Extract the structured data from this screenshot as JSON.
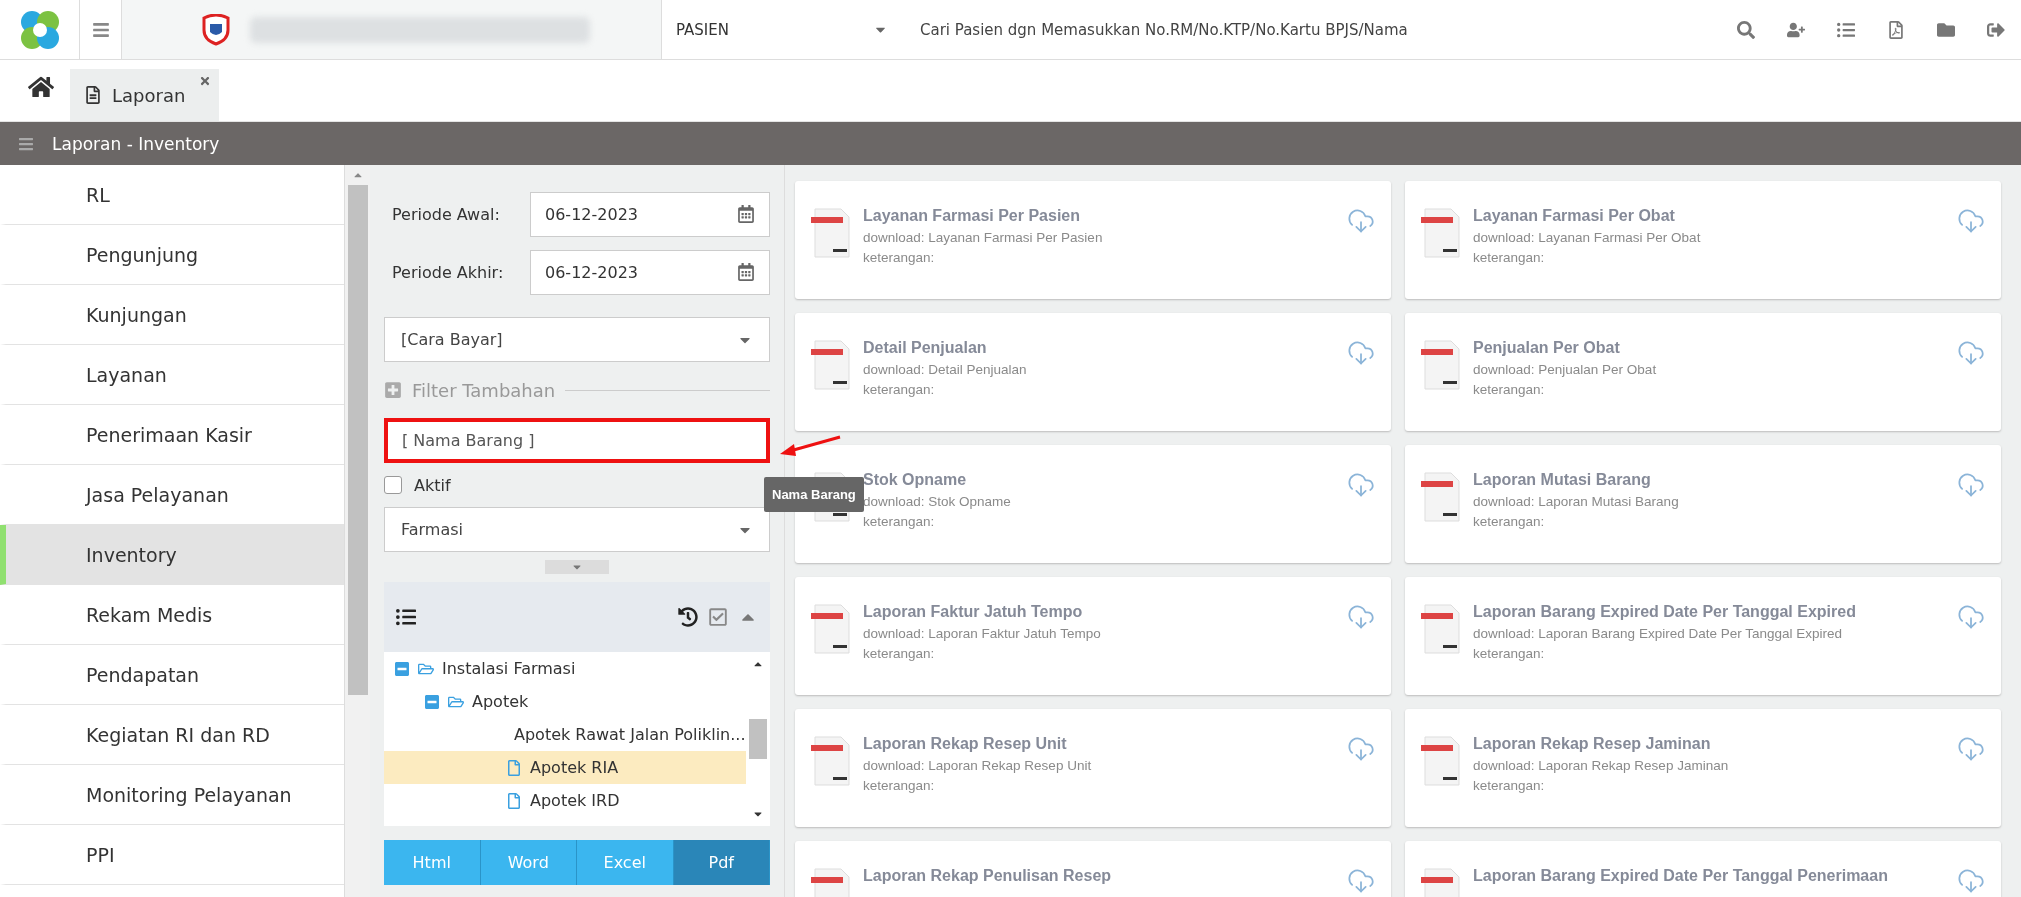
{
  "header": {
    "patient_select": "PASIEN",
    "search_placeholder": "Cari Pasien dgn Memasukkan No.RM/No.KTP/No.Kartu BPJS/Nama"
  },
  "tabs": [
    {
      "label": "Laporan",
      "selected": true
    }
  ],
  "section_title": "Laporan - Inventory",
  "sidebar": {
    "items": [
      {
        "label": "RL",
        "selected": false
      },
      {
        "label": "Pengunjung",
        "selected": false
      },
      {
        "label": "Kunjungan",
        "selected": false
      },
      {
        "label": "Layanan",
        "selected": false
      },
      {
        "label": "Penerimaan Kasir",
        "selected": false
      },
      {
        "label": "Jasa Pelayanan",
        "selected": false
      },
      {
        "label": "Inventory",
        "selected": true
      },
      {
        "label": "Rekam Medis",
        "selected": false
      },
      {
        "label": "Pendapatan",
        "selected": false
      },
      {
        "label": "Kegiatan RI dan RD",
        "selected": false
      },
      {
        "label": "Monitoring Pelayanan",
        "selected": false
      },
      {
        "label": "PPI",
        "selected": false
      }
    ]
  },
  "filters": {
    "period_start": {
      "label": "Periode Awal:",
      "value": "06-12-2023"
    },
    "period_end": {
      "label": "Periode Akhir:",
      "value": "06-12-2023"
    },
    "payment_select": "[Cara Bayar]",
    "extra_filter_label": "Filter Tambahan",
    "item_name": {
      "placeholder": "[ Nama Barang ]",
      "highlighted": true
    },
    "active": {
      "label": "Aktif",
      "checked": false
    },
    "unit_select": "Farmasi"
  },
  "tooltip": "Nama Barang",
  "tree": [
    {
      "label": "Instalasi Farmasi",
      "expanded": true,
      "selected": false,
      "children": [
        {
          "label": "Apotek",
          "expanded": true,
          "selected": false,
          "children": [
            {
              "label": "Apotek Rawat Jalan Poliklin...",
              "selected": false
            },
            {
              "label": "Apotek RIA",
              "selected": true
            },
            {
              "label": "Apotek IRD",
              "selected": false
            }
          ]
        }
      ]
    }
  ],
  "export_buttons": [
    {
      "label": "Html",
      "selected": false
    },
    {
      "label": "Word",
      "selected": false
    },
    {
      "label": "Excel",
      "selected": false
    },
    {
      "label": "Pdf",
      "selected": true
    }
  ],
  "reports": [
    {
      "title": "Layanan Farmasi Per Pasien",
      "download": "download: Layanan Farmasi Per Pasien",
      "note": "keterangan:"
    },
    {
      "title": "Layanan Farmasi Per Obat",
      "download": "download: Layanan Farmasi Per Obat",
      "note": "keterangan:"
    },
    {
      "title": "Detail Penjualan",
      "download": "download: Detail Penjualan",
      "note": "keterangan:"
    },
    {
      "title": "Penjualan Per Obat",
      "download": "download: Penjualan Per Obat",
      "note": "keterangan:"
    },
    {
      "title": "Stok Opname",
      "download": "download: Stok Opname",
      "note": "keterangan:"
    },
    {
      "title": "Laporan Mutasi Barang",
      "download": "download: Laporan Mutasi Barang",
      "note": "keterangan:"
    },
    {
      "title": "Laporan Faktur Jatuh Tempo",
      "download": "download: Laporan Faktur Jatuh Tempo",
      "note": "keterangan:"
    },
    {
      "title": "Laporan Barang Expired Date Per Tanggal Expired",
      "download": "download: Laporan Barang Expired Date Per Tanggal Expired",
      "note": "keterangan:"
    },
    {
      "title": "Laporan Rekap Resep Unit",
      "download": "download: Laporan Rekap Resep Unit",
      "note": "keterangan:"
    },
    {
      "title": "Laporan Rekap Resep Jaminan",
      "download": "download: Laporan Rekap Resep Jaminan",
      "note": "keterangan:"
    },
    {
      "title": "Laporan Rekap Penulisan Resep"
    },
    {
      "title": "Laporan Barang Expired Date Per Tanggal Penerimaan"
    }
  ]
}
